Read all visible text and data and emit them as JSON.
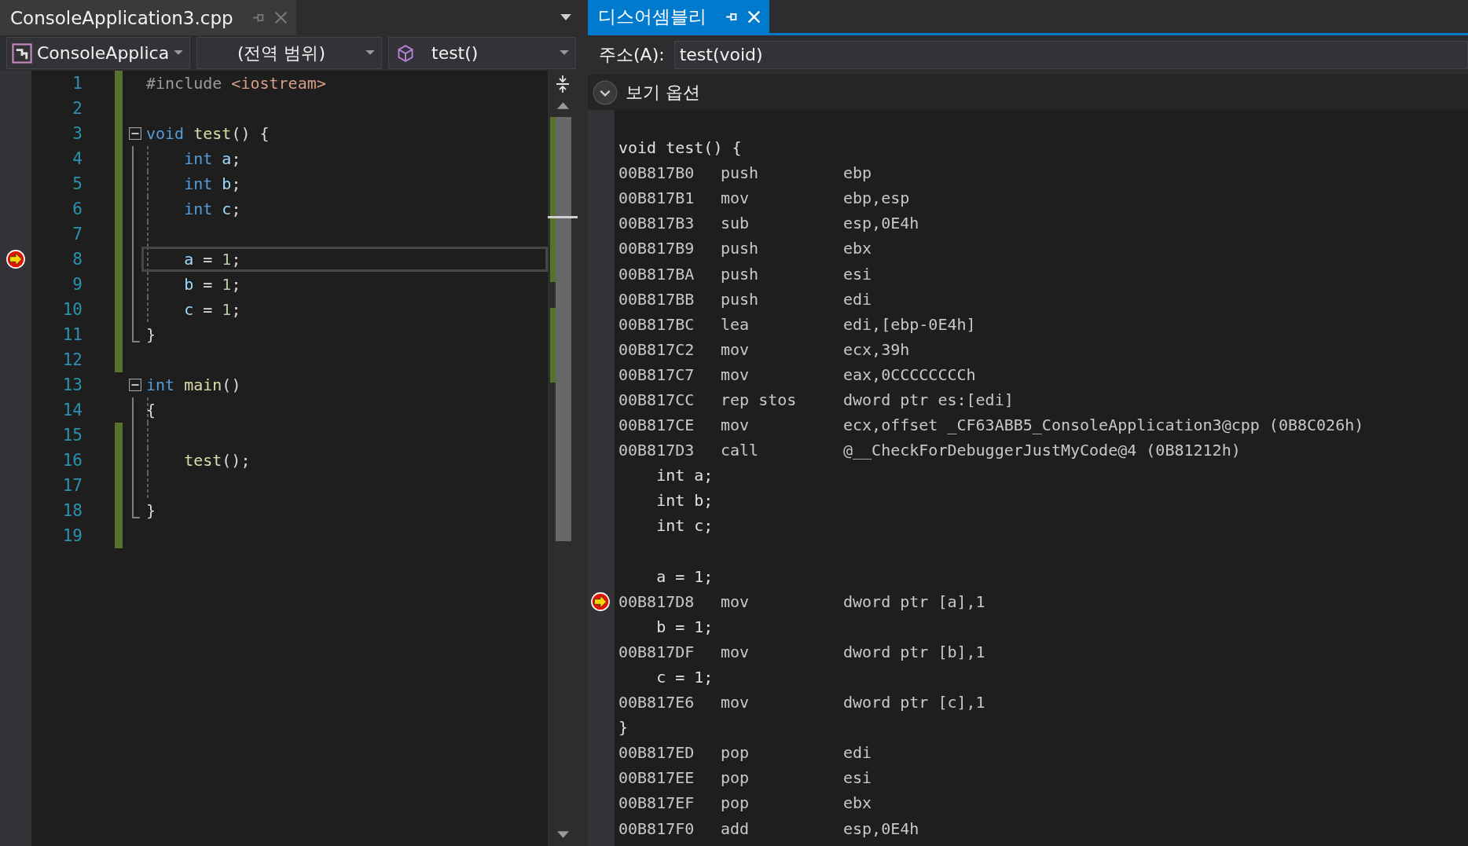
{
  "editor": {
    "tab": {
      "title": "ConsoleApplication3.cpp",
      "selected": false
    },
    "nav": {
      "project": "ConsoleApplica",
      "scope": "(전역 범위)",
      "member": "test()"
    },
    "lines": [
      {
        "number": "1",
        "changed": true,
        "current": false,
        "kind": "plain",
        "tokens": [
          {
            "text": "#include",
            "kind": "preproc"
          },
          {
            "text": " <iostream>",
            "kind": "string"
          }
        ]
      },
      {
        "number": "2",
        "changed": true,
        "current": false,
        "kind": "plain"
      },
      {
        "number": "3",
        "changed": true,
        "current": false,
        "kind": "start",
        "tokens": [
          {
            "text": "void",
            "kind": "keyword"
          },
          {
            "text": " test",
            "kind": "function"
          },
          {
            "text": "() {",
            "kind": "plain"
          }
        ]
      },
      {
        "number": "4",
        "changed": true,
        "current": false,
        "kind": "body",
        "tokens": [
          {
            "text": "    int",
            "kind": "keyword"
          },
          {
            "text": " a",
            "kind": "variable"
          },
          {
            "text": ";",
            "kind": "plain"
          }
        ]
      },
      {
        "number": "5",
        "changed": true,
        "current": false,
        "kind": "body",
        "tokens": [
          {
            "text": "    int",
            "kind": "keyword"
          },
          {
            "text": " b",
            "kind": "variable"
          },
          {
            "text": ";",
            "kind": "plain"
          }
        ]
      },
      {
        "number": "6",
        "changed": true,
        "current": false,
        "kind": "body",
        "tokens": [
          {
            "text": "    int",
            "kind": "keyword"
          },
          {
            "text": " c",
            "kind": "variable"
          },
          {
            "text": ";",
            "kind": "plain"
          }
        ]
      },
      {
        "number": "7",
        "changed": true,
        "current": false,
        "kind": "body"
      },
      {
        "number": "8",
        "changed": true,
        "current": true,
        "kind": "body",
        "tokens": [
          {
            "text": "    a",
            "kind": "variable"
          },
          {
            "text": " = ",
            "kind": "plain"
          },
          {
            "text": "1",
            "kind": "number"
          },
          {
            "text": ";",
            "kind": "plain"
          }
        ]
      },
      {
        "number": "9",
        "changed": true,
        "current": false,
        "kind": "body",
        "tokens": [
          {
            "text": "    b",
            "kind": "variable"
          },
          {
            "text": " = ",
            "kind": "plain"
          },
          {
            "text": "1",
            "kind": "number"
          },
          {
            "text": ";",
            "kind": "plain"
          }
        ]
      },
      {
        "number": "10",
        "changed": true,
        "current": false,
        "kind": "body",
        "tokens": [
          {
            "text": "    c",
            "kind": "variable"
          },
          {
            "text": " = ",
            "kind": "plain"
          },
          {
            "text": "1",
            "kind": "number"
          },
          {
            "text": ";",
            "kind": "plain"
          }
        ]
      },
      {
        "number": "11",
        "changed": true,
        "current": false,
        "kind": "end",
        "tokens": [
          {
            "text": "}",
            "kind": "plain"
          }
        ]
      },
      {
        "number": "12",
        "changed": true,
        "current": false,
        "kind": "plain"
      },
      {
        "number": "13",
        "changed": false,
        "current": false,
        "kind": "start",
        "tokens": [
          {
            "text": "int",
            "kind": "keyword"
          },
          {
            "text": " main",
            "kind": "function"
          },
          {
            "text": "()",
            "kind": "plain"
          }
        ]
      },
      {
        "number": "14",
        "changed": false,
        "current": false,
        "kind": "body",
        "tokens": [
          {
            "text": "{",
            "kind": "plain"
          }
        ]
      },
      {
        "number": "15",
        "changed": true,
        "current": false,
        "kind": "body"
      },
      {
        "number": "16",
        "changed": true,
        "current": false,
        "kind": "body",
        "tokens": [
          {
            "text": "    test",
            "kind": "function"
          },
          {
            "text": "();",
            "kind": "plain"
          }
        ]
      },
      {
        "number": "17",
        "changed": true,
        "current": false,
        "kind": "body"
      },
      {
        "number": "18",
        "changed": true,
        "current": false,
        "kind": "end",
        "tokens": [
          {
            "text": "}",
            "kind": "plain"
          }
        ]
      },
      {
        "number": "19",
        "changed": true,
        "current": false,
        "kind": "plain"
      }
    ]
  },
  "disassembly": {
    "tab": {
      "title": "디스어셈블리",
      "selected": true
    },
    "address_label": "주소(A):",
    "address": "test(void)",
    "view_options": "보기 옵션",
    "lines": [
      {
        "kind": "source",
        "text": "void test() {",
        "current": false
      },
      {
        "kind": "asm",
        "address": "00B817B0",
        "mnemonic": "push",
        "operands": "ebp",
        "current": false
      },
      {
        "kind": "asm",
        "address": "00B817B1",
        "mnemonic": "mov",
        "operands": "ebp,esp",
        "current": false
      },
      {
        "kind": "asm",
        "address": "00B817B3",
        "mnemonic": "sub",
        "operands": "esp,0E4h",
        "current": false
      },
      {
        "kind": "asm",
        "address": "00B817B9",
        "mnemonic": "push",
        "operands": "ebx",
        "current": false
      },
      {
        "kind": "asm",
        "address": "00B817BA",
        "mnemonic": "push",
        "operands": "esi",
        "current": false
      },
      {
        "kind": "asm",
        "address": "00B817BB",
        "mnemonic": "push",
        "operands": "edi",
        "current": false
      },
      {
        "kind": "asm",
        "address": "00B817BC",
        "mnemonic": "lea",
        "operands": "edi,[ebp-0E4h]",
        "current": false
      },
      {
        "kind": "asm",
        "address": "00B817C2",
        "mnemonic": "mov",
        "operands": "ecx,39h",
        "current": false
      },
      {
        "kind": "asm",
        "address": "00B817C7",
        "mnemonic": "mov",
        "operands": "eax,0CCCCCCCCh",
        "current": false
      },
      {
        "kind": "asm",
        "address": "00B817CC",
        "mnemonic": "rep stos",
        "operands": "dword ptr es:[edi]",
        "current": false
      },
      {
        "kind": "asm",
        "address": "00B817CE",
        "mnemonic": "mov",
        "operands": "ecx,offset _CF63ABB5_ConsoleApplication3@cpp (0B8C026h)",
        "current": false
      },
      {
        "kind": "asm",
        "address": "00B817D3",
        "mnemonic": "call",
        "operands": "@__CheckForDebuggerJustMyCode@4 (0B81212h)",
        "current": false
      },
      {
        "kind": "source",
        "text": "    int a;",
        "current": false
      },
      {
        "kind": "source",
        "text": "    int b;",
        "current": false
      },
      {
        "kind": "source",
        "text": "    int c;",
        "current": false
      },
      {
        "kind": "blank",
        "current": false
      },
      {
        "kind": "source",
        "text": "    a = 1;",
        "current": false
      },
      {
        "kind": "asm",
        "address": "00B817D8",
        "mnemonic": "mov",
        "operands": "dword ptr [a],1",
        "current": true
      },
      {
        "kind": "source",
        "text": "    b = 1;",
        "current": false
      },
      {
        "kind": "asm",
        "address": "00B817DF",
        "mnemonic": "mov",
        "operands": "dword ptr [b],1",
        "current": false
      },
      {
        "kind": "source",
        "text": "    c = 1;",
        "current": false
      },
      {
        "kind": "asm",
        "address": "00B817E6",
        "mnemonic": "mov",
        "operands": "dword ptr [c],1",
        "current": false
      },
      {
        "kind": "source",
        "text": "}",
        "current": false
      },
      {
        "kind": "asm",
        "address": "00B817ED",
        "mnemonic": "pop",
        "operands": "edi",
        "current": false
      },
      {
        "kind": "asm",
        "address": "00B817EE",
        "mnemonic": "pop",
        "operands": "esi",
        "current": false
      },
      {
        "kind": "asm",
        "address": "00B817EF",
        "mnemonic": "pop",
        "operands": "ebx",
        "current": false
      },
      {
        "kind": "asm",
        "address": "00B817F0",
        "mnemonic": "add",
        "operands": "esp,0E4h",
        "current": false
      }
    ]
  }
}
